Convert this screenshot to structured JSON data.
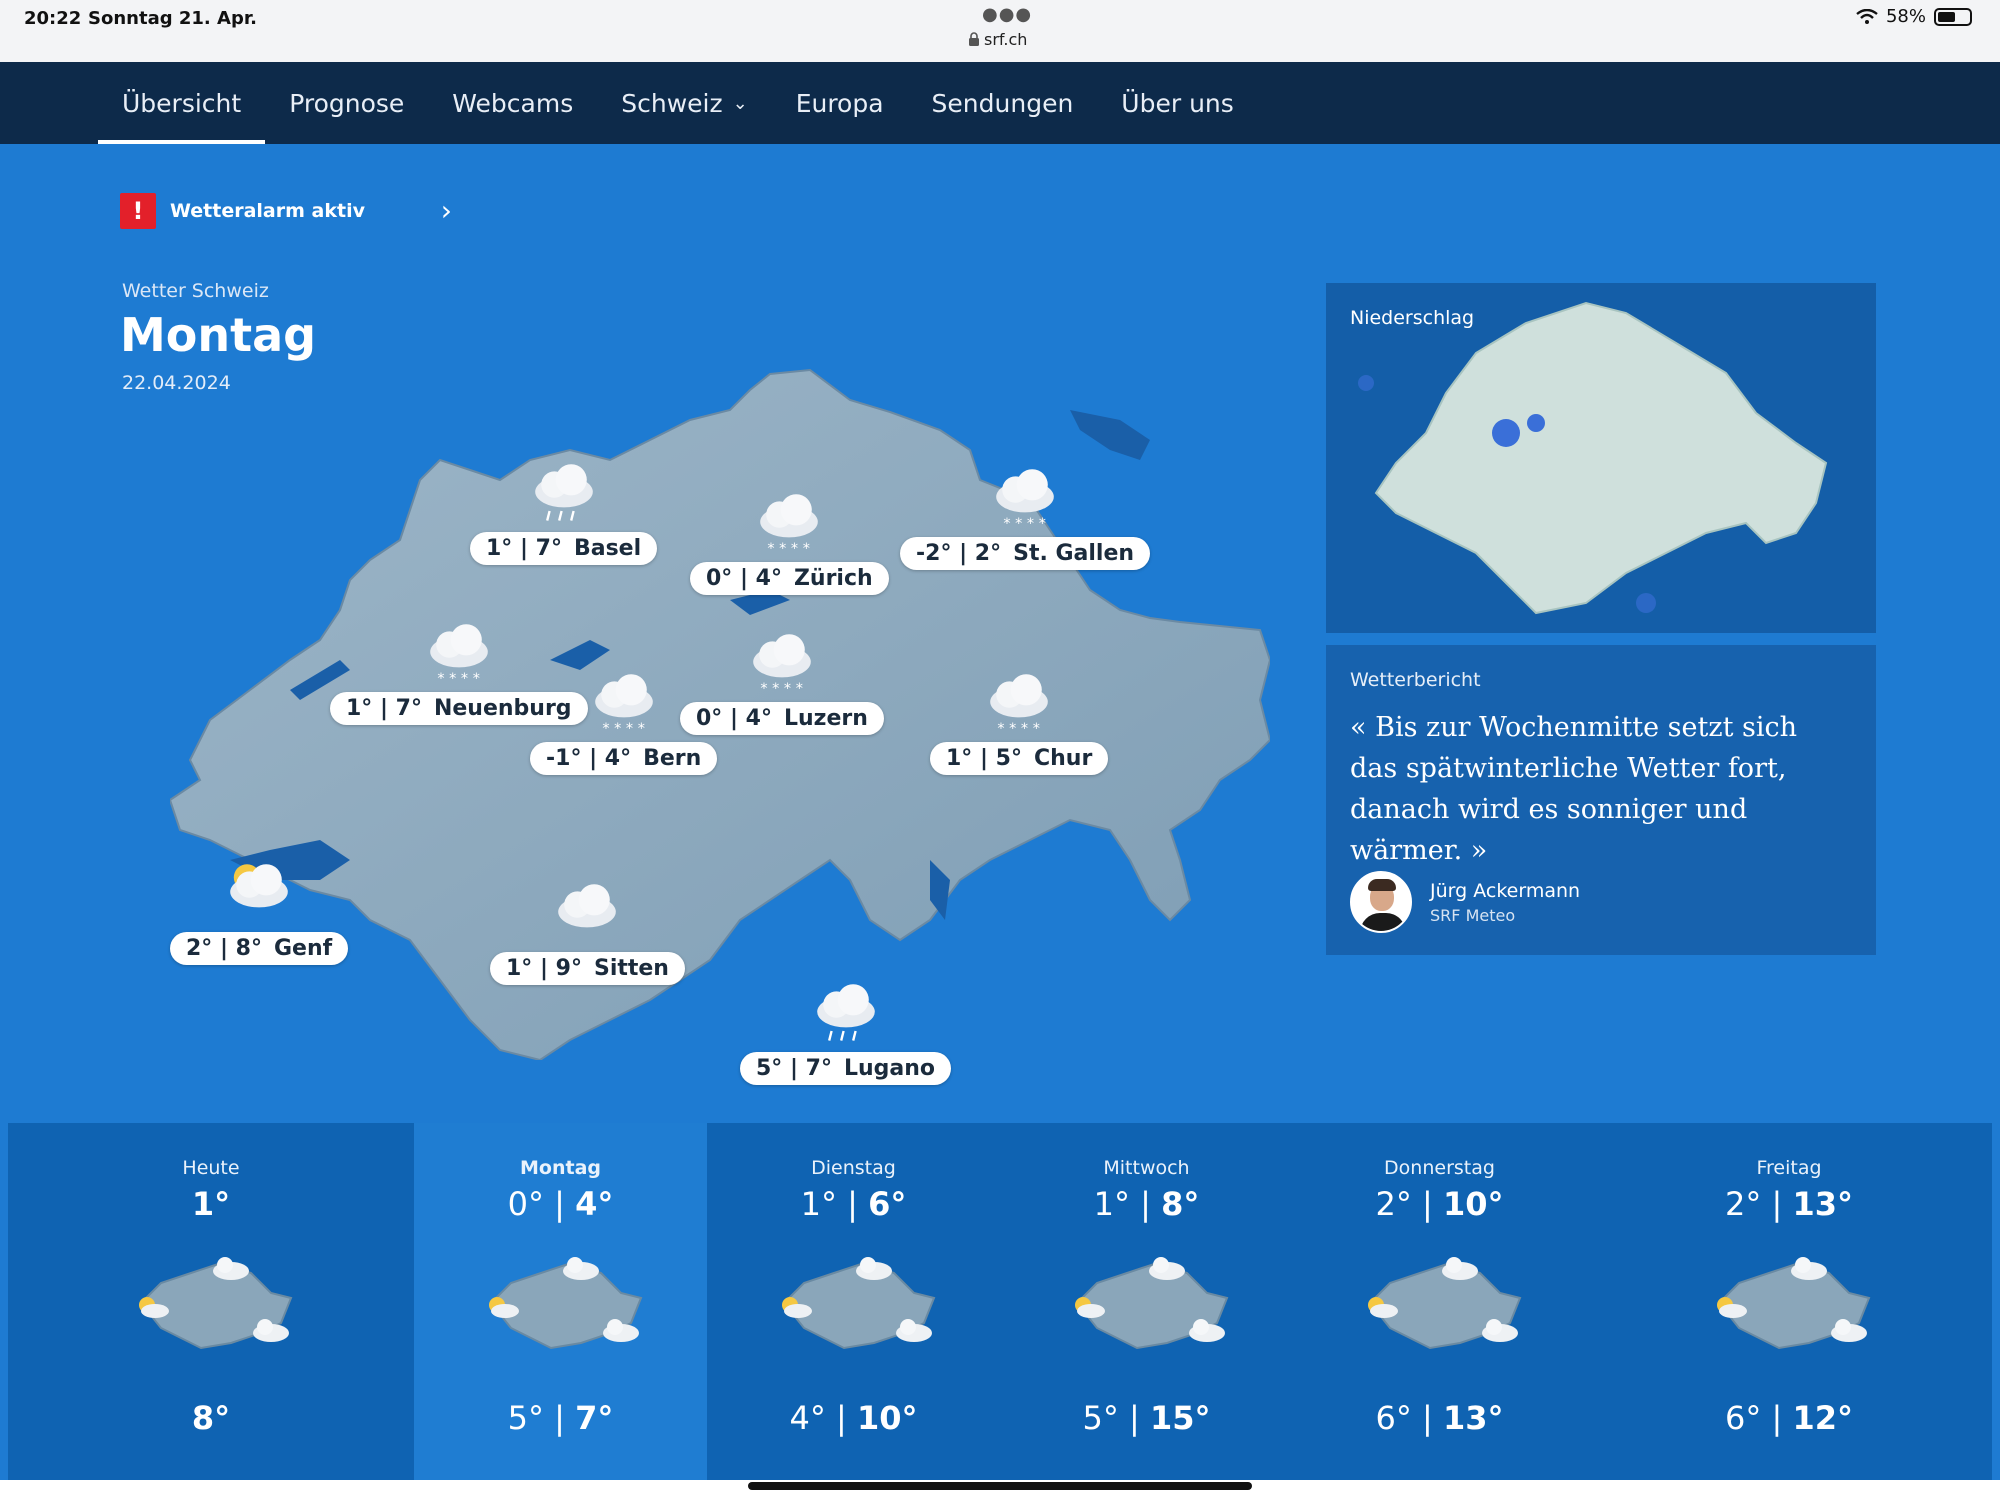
{
  "status_bar": {
    "time": "20:22",
    "date": "Sonntag 21. Apr.",
    "url": "srf.ch",
    "battery": "58%",
    "battery_level": 0.58
  },
  "nav": {
    "items": [
      "Übersicht",
      "Prognose",
      "Webcams",
      "Schweiz",
      "Europa",
      "Sendungen",
      "Über uns"
    ],
    "active": "Übersicht"
  },
  "alarm": {
    "label": "Wetteralarm aktiv"
  },
  "heading": {
    "subtitle": "Wetter Schweiz",
    "title": "Montag",
    "date": "22.04.2024"
  },
  "map_cities": [
    {
      "name": "Basel",
      "temps": "1° | 7°",
      "icon": "cloud-rain-icon"
    },
    {
      "name": "Zürich",
      "temps": "0° | 4°",
      "icon": "cloud-snow-icon"
    },
    {
      "name": "St. Gallen",
      "temps": "-2° | 2°",
      "icon": "cloud-snow-icon"
    },
    {
      "name": "Neuenburg",
      "temps": "1° | 7°",
      "icon": "cloud-snow-icon"
    },
    {
      "name": "Luzern",
      "temps": "0° | 4°",
      "icon": "cloud-snow-icon"
    },
    {
      "name": "Bern",
      "temps": "-1° | 4°",
      "icon": "cloud-snow-icon"
    },
    {
      "name": "Chur",
      "temps": "1° | 5°",
      "icon": "cloud-snow-icon"
    },
    {
      "name": "Genf",
      "temps": "2° | 8°",
      "icon": "sun-cloud-icon"
    },
    {
      "name": "Sitten",
      "temps": "1° | 9°",
      "icon": "cloud-icon"
    },
    {
      "name": "Lugano",
      "temps": "5° | 7°",
      "icon": "cloud-rain-icon"
    }
  ],
  "radar": {
    "title": "Niederschlag"
  },
  "report": {
    "title": "Wetterbericht",
    "quote": "« Bis zur Wochenmitte setzt sich das spätwinterliche Wetter fort, danach wird es sonniger und wärmer. »",
    "author_name": "Jürg Ackermann",
    "author_role": "SRF Meteo"
  },
  "forecast": [
    {
      "day": "Heute",
      "low": "",
      "high": "1°",
      "north_low": "",
      "north_high": "8°"
    },
    {
      "day": "Montag",
      "low": "0°",
      "high": "4°",
      "north_low": "5°",
      "north_high": "7°"
    },
    {
      "day": "Dienstag",
      "low": "1°",
      "high": "6°",
      "north_low": "4°",
      "north_high": "10°"
    },
    {
      "day": "Mittwoch",
      "low": "1°",
      "high": "8°",
      "north_low": "5°",
      "north_high": "15°"
    },
    {
      "day": "Donnerstag",
      "low": "2°",
      "high": "10°",
      "north_low": "6°",
      "north_high": "13°"
    },
    {
      "day": "Freitag",
      "low": "2°",
      "high": "13°",
      "north_low": "6°",
      "north_high": "12°"
    }
  ],
  "colors": {
    "background": "#1e7bd2",
    "nav": "#0d2a4a",
    "alarm": "#e3202a",
    "strip": "#0f63b2",
    "strip_selected": "#1f7dd2"
  }
}
